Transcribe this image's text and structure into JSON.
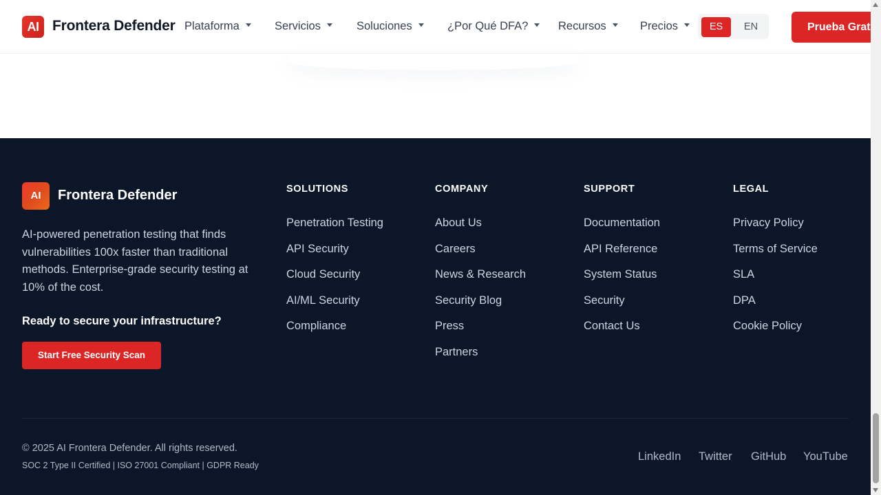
{
  "header": {
    "logo_mark": "AI",
    "brand": "Frontera Defender",
    "nav": [
      "Plataforma",
      "Servicios",
      "Soluciones",
      "¿Por Qué DFA?",
      "Recursos",
      "Precios"
    ],
    "lang": {
      "es": "ES",
      "en": "EN",
      "active": "ES"
    },
    "cta": "Prueba Gratis"
  },
  "footer": {
    "logo_mark": "AI",
    "brand": "Frontera Defender",
    "description": "AI-powered penetration testing that finds vulnerabilities 100x faster than traditional methods. Enterprise-grade security testing at 10% of the cost.",
    "ready": "Ready to secure your infrastructure?",
    "cta": "Start Free Security Scan",
    "columns": [
      {
        "heading": "SOLUTIONS",
        "links": [
          "Penetration Testing",
          "API Security",
          "Cloud Security",
          "AI/ML Security",
          "Compliance"
        ]
      },
      {
        "heading": "COMPANY",
        "links": [
          "About Us",
          "Careers",
          "News & Research",
          "Security Blog",
          "Press",
          "Partners"
        ]
      },
      {
        "heading": "SUPPORT",
        "links": [
          "Documentation",
          "API Reference",
          "System Status",
          "Security",
          "Contact Us"
        ]
      },
      {
        "heading": "LEGAL",
        "links": [
          "Privacy Policy",
          "Terms of Service",
          "SLA",
          "DPA",
          "Cookie Policy"
        ]
      }
    ],
    "copyright": "© 2025 AI Frontera Defender. All rights reserved.",
    "certifications": "SOC 2 Type II Certified | ISO 27001 Compliant | GDPR Ready",
    "social": [
      "LinkedIn",
      "Twitter",
      "GitHub",
      "YouTube"
    ]
  },
  "colors": {
    "accent": "#dc2626",
    "footer_bg": "#0b1628",
    "footer_text": "#cbd5e1"
  }
}
